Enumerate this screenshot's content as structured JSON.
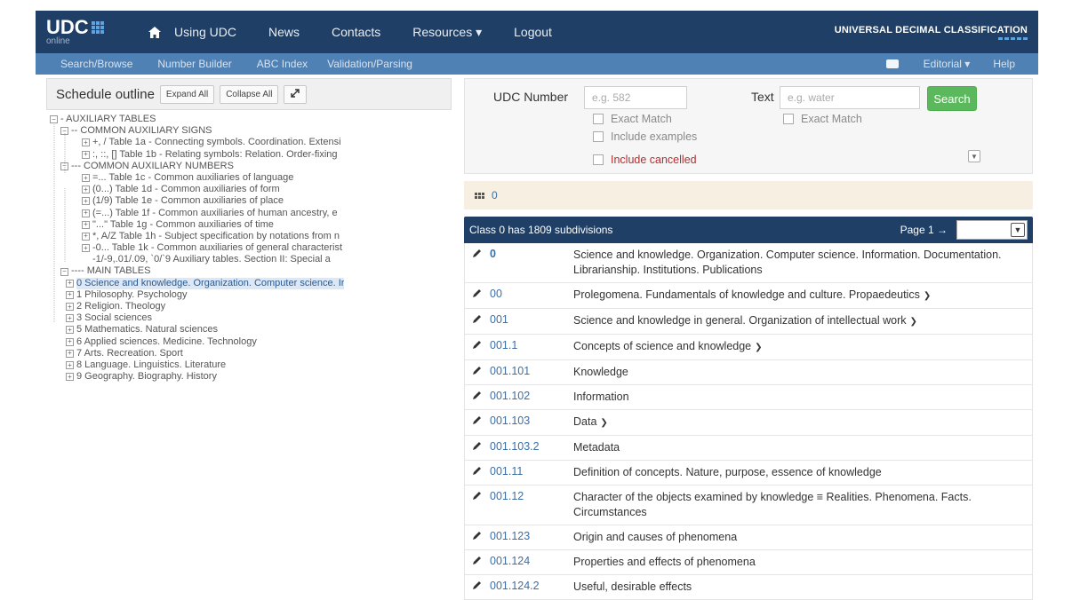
{
  "topnav": {
    "logo_main": "UDC",
    "logo_sub": "online",
    "links": [
      "Using UDC",
      "News",
      "Contacts",
      "Resources ▾",
      "Logout"
    ],
    "brand": "UNIVERSAL DECIMAL CLASSIFICATION"
  },
  "subnav": {
    "links": [
      "Search/Browse",
      "Number Builder",
      "ABC Index",
      "Validation/Parsing"
    ],
    "editorial": "Editorial ▾",
    "help": "Help"
  },
  "outline": {
    "title": "Schedule outline",
    "expand_all": "Expand All",
    "collapse_all": "Collapse All",
    "nodes": [
      {
        "label": "- AUXILIARY TABLES"
      },
      {
        "label": "-- COMMON AUXILIARY SIGNS"
      },
      {
        "label": "+, / Table 1a - Connecting symbols. Coordination. Extensi"
      },
      {
        "label": ":, ::, [] Table 1b - Relating symbols: Relation. Order-fixing"
      },
      {
        "label": "--- COMMON AUXILIARY NUMBERS"
      },
      {
        "label": "=... Table 1c - Common auxiliaries of language"
      },
      {
        "label": "(0...) Table 1d - Common auxiliaries of form"
      },
      {
        "label": "(1/9) Table 1e - Common auxiliaries of place"
      },
      {
        "label": "(=...) Table 1f - Common auxiliaries of human ancestry, e"
      },
      {
        "label": "\"...\" Table 1g - Common auxiliaries of time"
      },
      {
        "label": "*, A/Z Table 1h - Subject specification by notations from n"
      },
      {
        "label": "-0... Table 1k - Common auxiliaries of general characterist"
      },
      {
        "label": "-1/-9,.01/.09, `0/`9 Auxiliary tables. Section II: Special a"
      },
      {
        "label": "---- MAIN TABLES"
      },
      {
        "label": "0 Science and knowledge. Organization. Computer science. Ir"
      },
      {
        "label": "1 Philosophy. Psychology"
      },
      {
        "label": "2 Religion. Theology"
      },
      {
        "label": "3 Social sciences"
      },
      {
        "label": "5 Mathematics. Natural sciences"
      },
      {
        "label": "6 Applied sciences. Medicine. Technology"
      },
      {
        "label": "7 Arts. Recreation. Sport"
      },
      {
        "label": "8 Language. Linguistics. Literature"
      },
      {
        "label": "9 Geography. Biography. History"
      }
    ]
  },
  "search": {
    "udc_label": "UDC Number",
    "udc_placeholder": "e.g. 582",
    "text_label": "Text",
    "text_placeholder": "e.g. water",
    "search_button": "Search",
    "exact_match_1": "Exact Match",
    "exact_match_2": "Exact Match",
    "include_examples": "Include examples",
    "include_cancelled": "Include cancelled"
  },
  "crumb": "0",
  "results": {
    "heading": "Class 0 has 1809 subdivisions",
    "page": "Page 1 →",
    "rows": [
      {
        "code": "0",
        "desc": "Science and knowledge. Organization. Computer science. Information. Documentation. Librarianship. Institutions. Publications"
      },
      {
        "code": "00",
        "desc": "Prolegomena. Fundamentals of knowledge and culture. Propaedeutics"
      },
      {
        "code": "001",
        "desc": "Science and knowledge in general. Organization of intellectual work"
      },
      {
        "code": "001.1",
        "desc": "Concepts of science and knowledge"
      },
      {
        "code": "001.101",
        "desc": "Knowledge"
      },
      {
        "code": "001.102",
        "desc": "Information"
      },
      {
        "code": "001.103",
        "desc": "Data"
      },
      {
        "code": "001.103.2",
        "desc": "Metadata"
      },
      {
        "code": "001.11",
        "desc": "Definition of concepts. Nature, purpose, essence of knowledge"
      },
      {
        "code": "001.12",
        "desc": "Character of the objects examined by knowledge ≡ Realities. Phenomena. Facts. Circumstances"
      },
      {
        "code": "001.123",
        "desc": "Origin and causes of phenomena"
      },
      {
        "code": "001.124",
        "desc": "Properties and effects of phenomena"
      },
      {
        "code": "001.124.2",
        "desc": "Useful, desirable effects"
      }
    ]
  },
  "colors": {
    "navbar": "#1f3f66",
    "subnav": "#4f81b5",
    "search_button": "#5cb85c",
    "link": "#3b6ea5",
    "crumb_bg": "#f7efe1"
  }
}
